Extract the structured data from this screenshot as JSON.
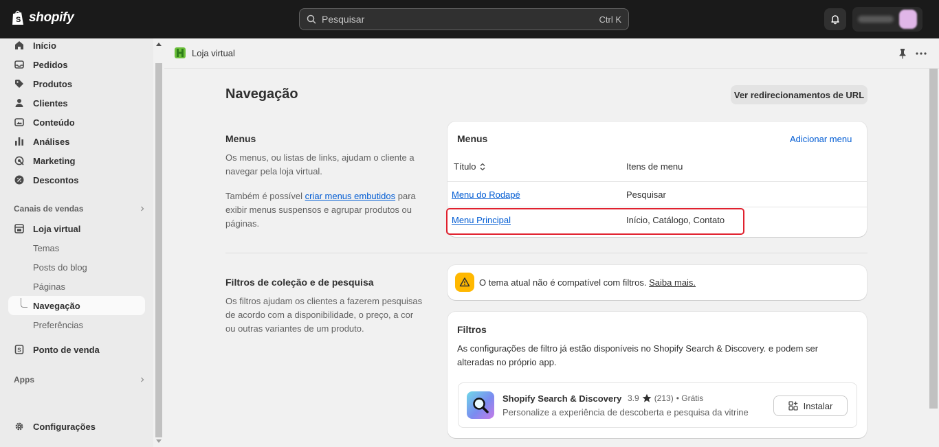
{
  "topbar": {
    "brand": "shopify",
    "search_placeholder": "Pesquisar",
    "search_shortcut": "Ctrl K"
  },
  "sidebar": {
    "main_items": [
      {
        "label": "Início",
        "icon": "home-icon"
      },
      {
        "label": "Pedidos",
        "icon": "inbox-icon"
      },
      {
        "label": "Produtos",
        "icon": "tag-icon"
      },
      {
        "label": "Clientes",
        "icon": "person-icon"
      },
      {
        "label": "Conteúdo",
        "icon": "image-icon"
      },
      {
        "label": "Análises",
        "icon": "bar-chart-icon"
      },
      {
        "label": "Marketing",
        "icon": "target-icon"
      },
      {
        "label": "Descontos",
        "icon": "discount-icon"
      }
    ],
    "sales_channels_label": "Canais de vendas",
    "online_store": {
      "label": "Loja virtual",
      "sub_items": [
        "Temas",
        "Posts do blog",
        "Páginas",
        "Navegação",
        "Preferências"
      ],
      "active_sub_item": "Navegação"
    },
    "pos_label": "Ponto de venda",
    "apps_label": "Apps",
    "settings_label": "Configurações"
  },
  "header": {
    "breadcrumb": "Loja virtual"
  },
  "page": {
    "title": "Navegação",
    "redirects_button": "Ver redirecionamentos de URL"
  },
  "menus_section": {
    "title": "Menus",
    "description": "Os menus, ou listas de links, ajudam o cliente a navegar pela loja virtual.",
    "extra_prefix": "Também é possível",
    "extra_link": "criar menus embutidos",
    "extra_suffix": "para exibir menus suspensos e agrupar produtos ou páginas.",
    "card_title": "Menus",
    "add_menu": "Adicionar menu",
    "columns": [
      "Título",
      "Itens de menu"
    ],
    "rows": [
      {
        "title": "Menu do Rodapé",
        "items": "Pesquisar"
      },
      {
        "title": "Menu Principal",
        "items": "Início, Catálogo, Contato"
      }
    ]
  },
  "filters_section": {
    "title": "Filtros de coleção e de pesquisa",
    "description": "Os filtros ajudam os clientes a fazerem pesquisas de acordo com a disponibilidade, o preço, a cor ou outras variantes de um produto.",
    "warning_text": "O tema atual não é compatível com filtros.",
    "warning_link": "Saiba mais.",
    "card_title": "Filtros",
    "card_text": "As configurações de filtro já estão disponíveis no Shopify Search & Discovery. e podem ser alteradas no próprio app.",
    "app": {
      "name": "Shopify Search & Discovery",
      "rating": "3.9",
      "reviews": "(213)",
      "price": "• Grátis",
      "description": "Personalize a experiência de descoberta e pesquisa da vitrine",
      "install_label": "Instalar"
    }
  },
  "colors": {
    "topbar": "#1a1a1a",
    "link": "#005bd3",
    "highlight": "#e0212e",
    "warning": "#ffb800"
  }
}
